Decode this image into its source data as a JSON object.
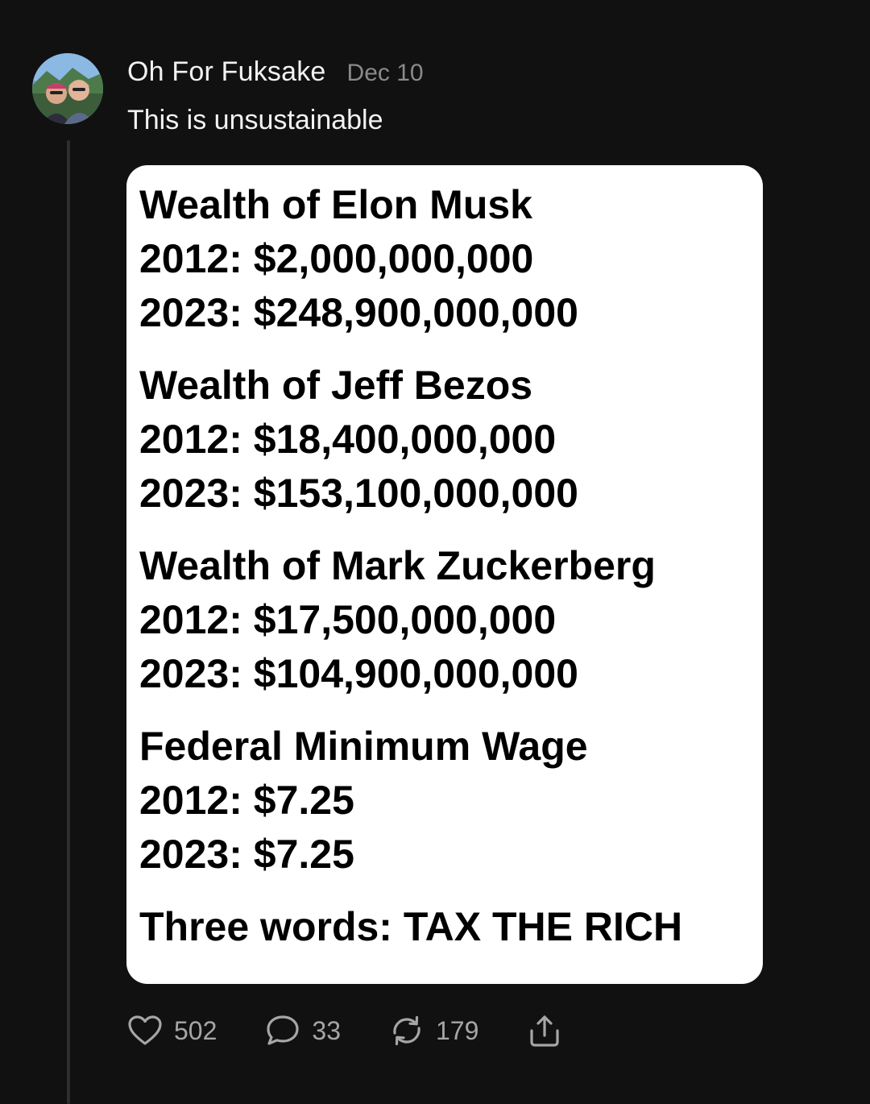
{
  "post": {
    "author": "Oh For Fuksake",
    "date": "Dec 10",
    "text": "This is unsustainable",
    "avatar_icon": "avatar-photo"
  },
  "card": {
    "blocks": [
      {
        "heading": "Wealth of Elon Musk",
        "lines": [
          "2012: $2,000,000,000",
          "2023: $248,900,000,000"
        ]
      },
      {
        "heading": "Wealth of Jeff Bezos",
        "lines": [
          "2012: $18,400,000,000",
          "2023: $153,100,000,000"
        ]
      },
      {
        "heading": "Wealth of Mark Zuckerberg",
        "lines": [
          "2012: $17,500,000,000",
          "2023: $104,900,000,000"
        ]
      },
      {
        "heading": "Federal Minimum Wage",
        "lines": [
          "2012: $7.25",
          "2023: $7.25"
        ]
      }
    ],
    "closing": "Three words: TAX THE RICH"
  },
  "actions": {
    "likes": "502",
    "comments": "33",
    "reposts": "179",
    "icons": [
      "heart-icon",
      "comment-icon",
      "repost-icon",
      "share-icon"
    ]
  },
  "colors": {
    "background": "#111111",
    "card": "#ffffff",
    "muted_text": "#8a8a8a",
    "action_text": "#a6a6a6"
  }
}
